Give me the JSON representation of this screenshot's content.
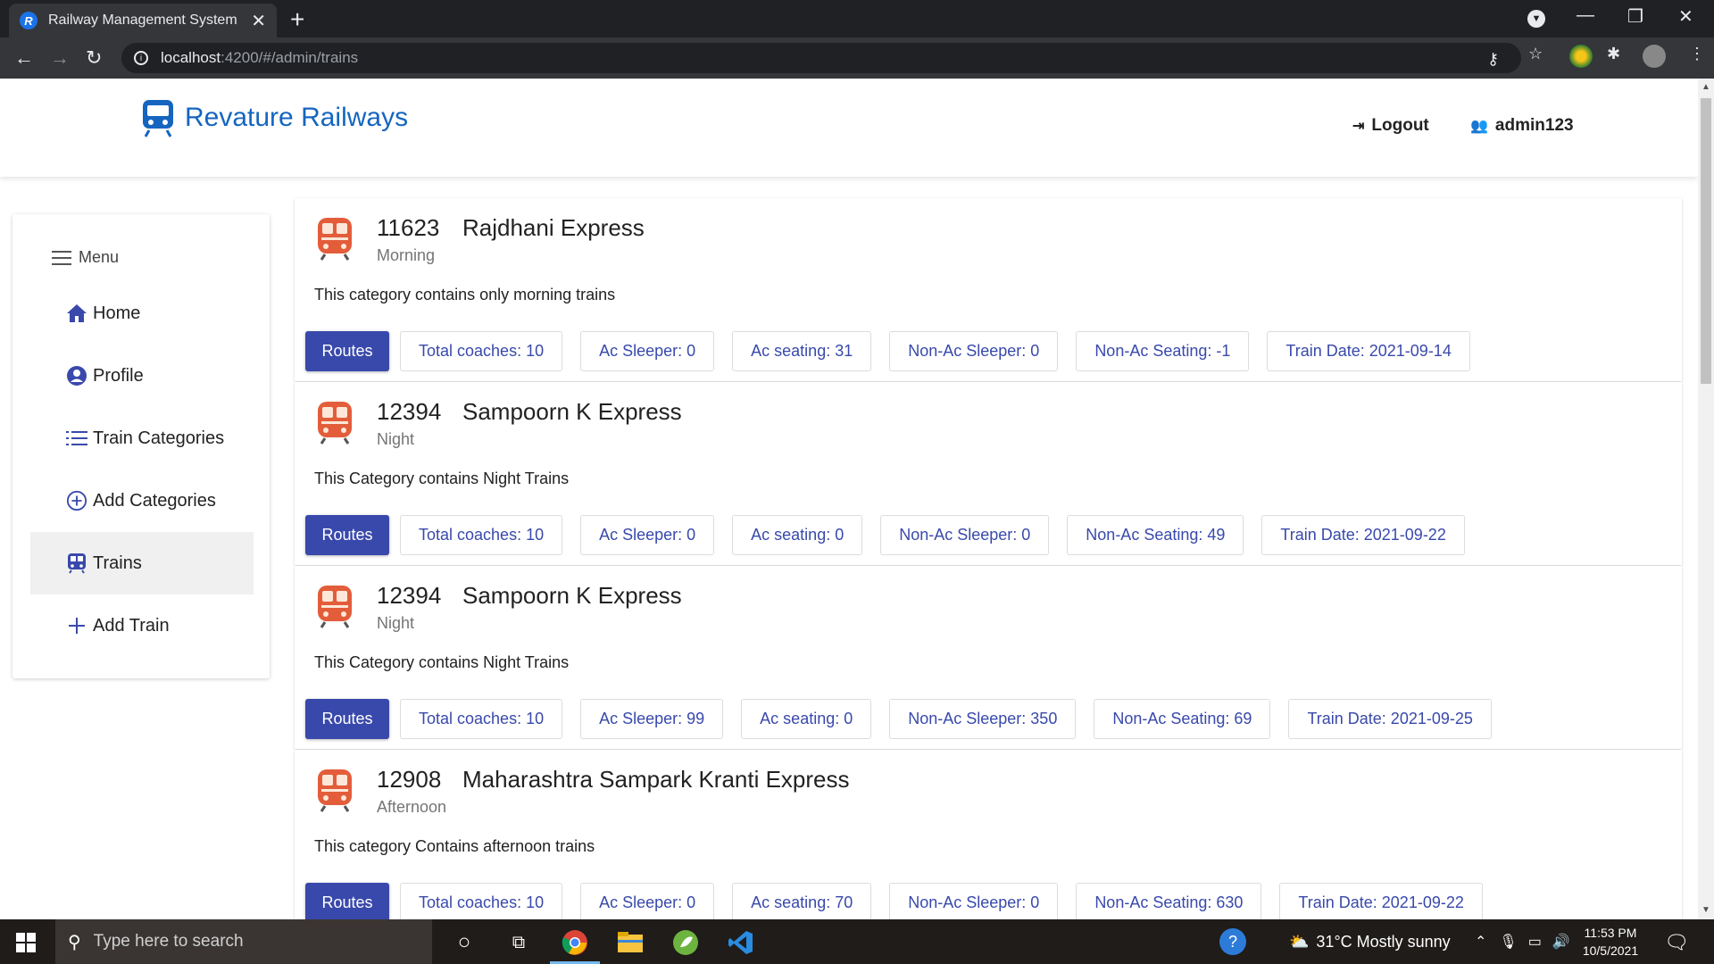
{
  "browser": {
    "tab_title": "Railway Management System",
    "favicon_letter": "R",
    "url_host": "localhost",
    "url_path": ":4200/#/admin/trains"
  },
  "header": {
    "brand": "Revature Railways",
    "logout": "Logout",
    "user": "admin123"
  },
  "sidebar": {
    "menu_label": "Menu",
    "items": [
      {
        "label": "Home",
        "icon": "home-icon"
      },
      {
        "label": "Profile",
        "icon": "user-circle-icon"
      },
      {
        "label": "Train Categories",
        "icon": "list-icon"
      },
      {
        "label": "Add Categories",
        "icon": "plus-circle-icon"
      },
      {
        "label": "Trains",
        "icon": "train-icon",
        "active": true
      },
      {
        "label": "Add Train",
        "icon": "plus-icon"
      }
    ]
  },
  "trains": [
    {
      "number": "11623",
      "name": "Rajdhani Express",
      "category": "Morning",
      "description": "This category contains only morning trains",
      "routes_label": "Routes",
      "chips": [
        "Total coaches: 10",
        "Ac Sleeper: 0",
        "Ac seating: 31",
        "Non-Ac Sleeper: 0",
        "Non-Ac Seating: -1",
        "Train Date: 2021-09-14"
      ]
    },
    {
      "number": "12394",
      "name": "Sampoorn K Express",
      "category": "Night",
      "description": "This Category contains Night Trains",
      "routes_label": "Routes",
      "chips": [
        "Total coaches: 10",
        "Ac Sleeper: 0",
        "Ac seating: 0",
        "Non-Ac Sleeper: 0",
        "Non-Ac Seating: 49",
        "Train Date: 2021-09-22"
      ]
    },
    {
      "number": "12394",
      "name": "Sampoorn K Express",
      "category": "Night",
      "description": "This Category contains Night Trains",
      "routes_label": "Routes",
      "chips": [
        "Total coaches: 10",
        "Ac Sleeper: 99",
        "Ac seating: 0",
        "Non-Ac Sleeper: 350",
        "Non-Ac Seating: 69",
        "Train Date: 2021-09-25"
      ]
    },
    {
      "number": "12908",
      "name": "Maharashtra Sampark Kranti Express",
      "category": "Afternoon",
      "description": "This category Contains afternoon trains",
      "routes_label": "Routes",
      "chips": [
        "Total coaches: 10",
        "Ac Sleeper: 0",
        "Ac seating: 70",
        "Non-Ac Sleeper: 0",
        "Non-Ac Seating: 630",
        "Train Date: 2021-09-22"
      ]
    }
  ],
  "taskbar": {
    "search_placeholder": "Type here to search",
    "weather": "31°C  Mostly sunny",
    "time": "11:53 PM",
    "date": "10/5/2021"
  },
  "colors": {
    "brand": "#1565c0",
    "accent": "#3949ab",
    "train_icon": "#e35d3a"
  }
}
